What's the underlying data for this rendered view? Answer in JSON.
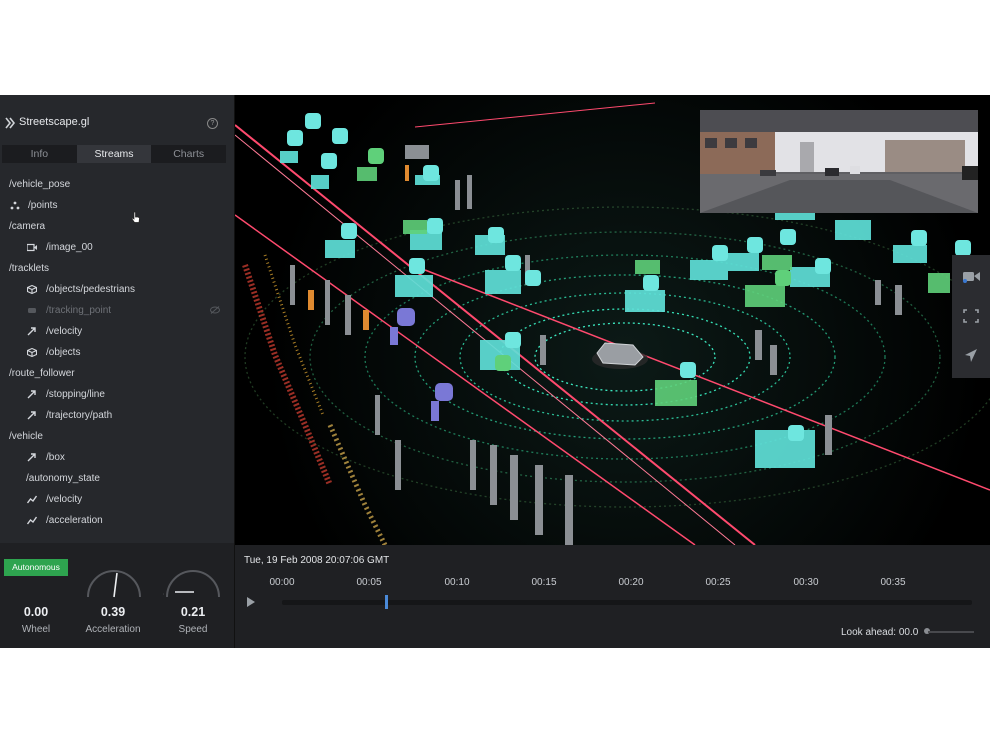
{
  "app": {
    "title": "Streetscape.gl",
    "help_glyph": "?"
  },
  "tabs": [
    {
      "label": "Info",
      "active": false
    },
    {
      "label": "Streams",
      "active": true
    },
    {
      "label": "Charts",
      "active": false
    }
  ],
  "streams": [
    {
      "label": "/vehicle_pose",
      "indent": 0,
      "icon": ""
    },
    {
      "label": "/points",
      "indent": 1,
      "icon": "points-icon"
    },
    {
      "label": "/camera",
      "indent": 0,
      "icon": ""
    },
    {
      "label": "/image_00",
      "indent": 1,
      "icon": "camera-icon"
    },
    {
      "label": "/tracklets",
      "indent": 0,
      "icon": ""
    },
    {
      "label": "/objects/pedestrians",
      "indent": 1,
      "icon": "cube-icon"
    },
    {
      "label": "/tracking_point",
      "indent": 1,
      "icon": "point-icon",
      "disabled": true
    },
    {
      "label": "/velocity",
      "indent": 1,
      "icon": "arrow-icon"
    },
    {
      "label": "/objects",
      "indent": 1,
      "icon": "cube-icon"
    },
    {
      "label": "/route_follower",
      "indent": 0,
      "icon": ""
    },
    {
      "label": "/stopping/line",
      "indent": 1,
      "icon": "arrow-icon"
    },
    {
      "label": "/trajectory/path",
      "indent": 1,
      "icon": "arrow-icon"
    },
    {
      "label": "/vehicle",
      "indent": 0,
      "icon": ""
    },
    {
      "label": "/box",
      "indent": 1,
      "icon": "arrow-icon"
    },
    {
      "label": "/autonomy_state",
      "indent": 0.5,
      "icon": ""
    },
    {
      "label": "/velocity",
      "indent": 1,
      "icon": "chart-line-icon"
    },
    {
      "label": "/acceleration",
      "indent": 1,
      "icon": "chart-line-icon"
    }
  ],
  "status": {
    "autonomy_badge": "Autonomous",
    "badge_color": "#2ea44f"
  },
  "gauges": [
    {
      "label": "Wheel",
      "value": "0.00"
    },
    {
      "label": "Acceleration",
      "value": "0.39"
    },
    {
      "label": "Speed",
      "value": "0.21"
    }
  ],
  "timeline": {
    "date": "Tue, 19 Feb 2008 20:07:06 GMT",
    "ticks": [
      "00:00",
      "00:05",
      "00:10",
      "00:15",
      "00:20",
      "00:25",
      "00:30",
      "00:35"
    ],
    "playhead_fraction": 0.15,
    "look_ahead": "Look ahead: 00.0"
  },
  "colors": {
    "panel": "#26282c",
    "accent": "#4a8ad8",
    "lidar_near": "#2fe0b8",
    "object_teal": "#5fe0d8",
    "object_green": "#5fd07a",
    "trajectory": "#ff4a6e"
  },
  "viewport_tools": [
    "camera-icon",
    "fullscreen-icon",
    "navigate-icon"
  ]
}
